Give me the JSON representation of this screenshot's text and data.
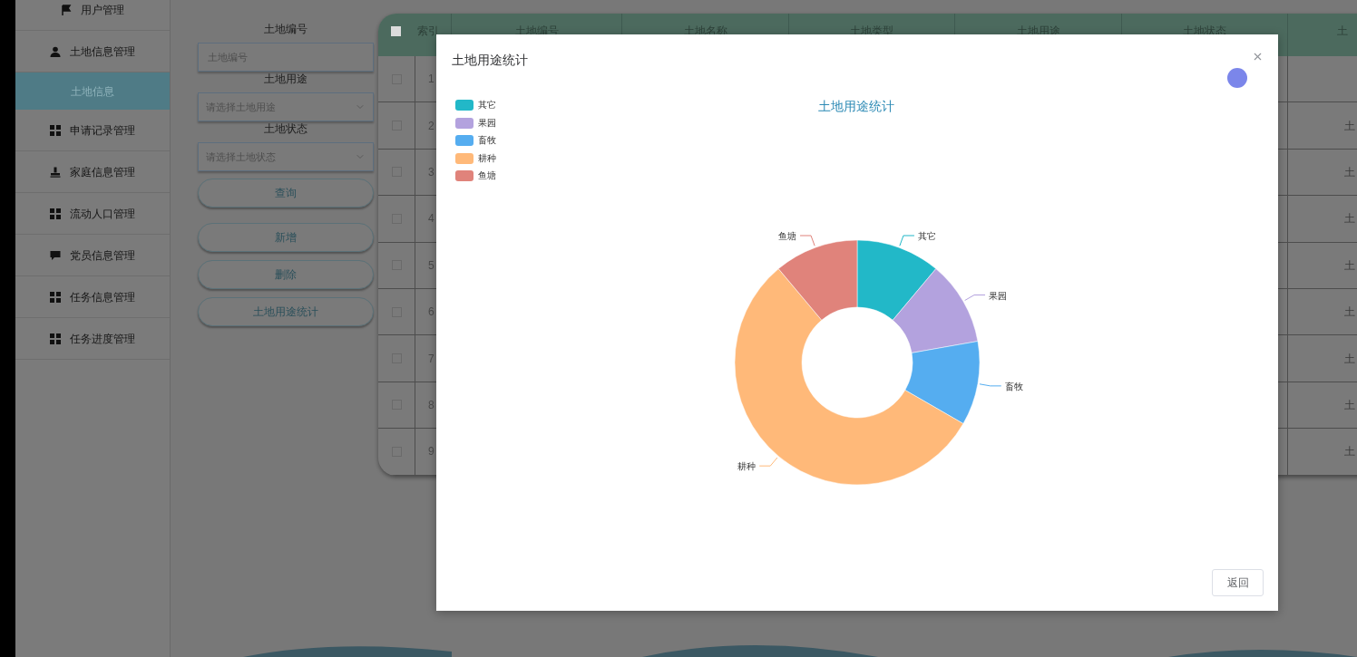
{
  "sidebar": {
    "items": [
      {
        "label": "用户管理",
        "selected": false
      },
      {
        "label": "土地信息管理",
        "selected": false,
        "children": [
          {
            "label": "土地信息",
            "selected": true
          }
        ]
      },
      {
        "label": "申请记录管理",
        "selected": false
      },
      {
        "label": "家庭信息管理",
        "selected": false
      },
      {
        "label": "流动人口管理",
        "selected": false
      },
      {
        "label": "党员信息管理",
        "selected": false
      },
      {
        "label": "任务信息管理",
        "selected": false
      },
      {
        "label": "任务进度管理",
        "selected": false
      }
    ]
  },
  "filters": [
    {
      "kind": "text",
      "label": "土地编号",
      "placeholder": "土地编号"
    },
    {
      "kind": "select",
      "label": "土地用途",
      "placeholder": "请选择土地用途"
    },
    {
      "kind": "select",
      "label": "土地状态",
      "placeholder": "请选择土地状态"
    }
  ],
  "buttons": [
    "查询",
    "新增",
    "删除",
    "土地用途统计"
  ],
  "table": {
    "columns": [
      "索引",
      "土地编号",
      "土地名称",
      "土地类型",
      "土地用途",
      "土地状态",
      "土"
    ],
    "rows": [
      {
        "checked": false,
        "index": "1"
      },
      {
        "checked": false,
        "index": "2",
        "column_7": "土"
      },
      {
        "checked": false,
        "index": "3",
        "column_7": "土"
      },
      {
        "checked": false,
        "index": "4",
        "column_7": "土"
      },
      {
        "checked": false,
        "index": "5",
        "column_7": "土"
      },
      {
        "checked": false,
        "index": "6",
        "column_7": "土"
      },
      {
        "checked": false,
        "index": "7",
        "column_7": "土"
      },
      {
        "checked": false,
        "index": "8",
        "column_7": "土"
      },
      {
        "checked": false,
        "index": "9",
        "column_7": "土"
      }
    ]
  },
  "modal": {
    "title": "土地用途统计",
    "chart": {
      "title": "土地用途统计",
      "legend": [
        {
          "label": "其它",
          "color": "#22b8c8"
        },
        {
          "label": "果园",
          "color": "#b3a2de"
        },
        {
          "label": "畜牧",
          "color": "#55adf0"
        },
        {
          "label": "耕种",
          "color": "#ffb979"
        },
        {
          "label": "鱼塘",
          "color": "#e0837b"
        }
      ],
      "slices": [
        {
          "label": "其它",
          "color": "#22b8c8"
        },
        {
          "label": "果园",
          "color": "#b3a2de"
        },
        {
          "label": "畜牧",
          "color": "#55adf0"
        },
        {
          "label": "耕种",
          "color": "#ffb979"
        },
        {
          "label": "鱼塘",
          "color": "#e0837b"
        }
      ]
    },
    "button": "返回"
  }
}
